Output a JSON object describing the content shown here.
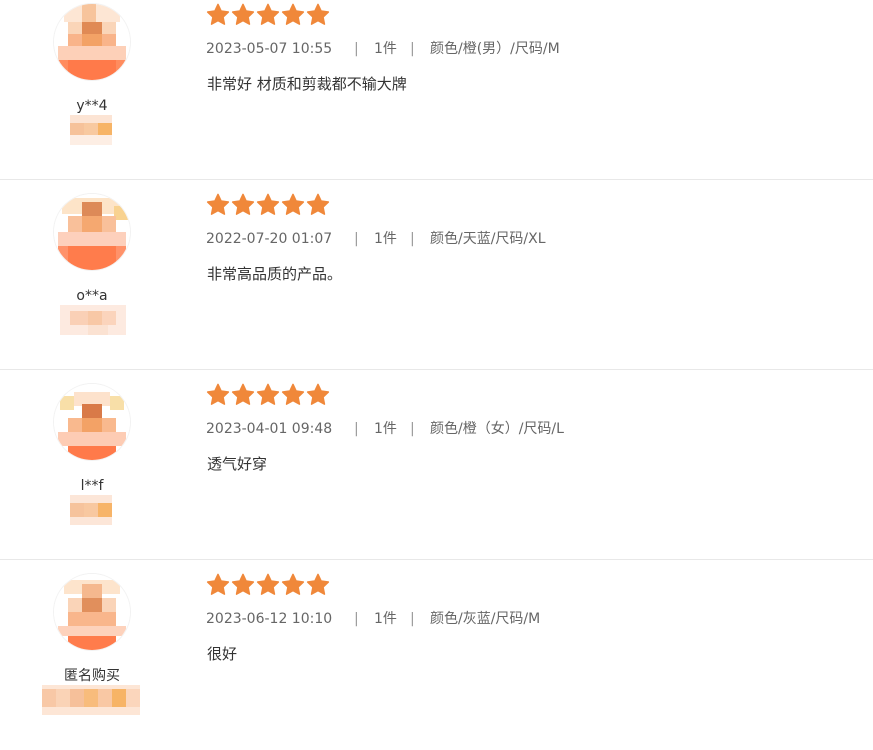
{
  "colors": {
    "star": "#f0883a",
    "divider": "#e8e8e8",
    "text": "#333333",
    "meta_text": "#666666"
  },
  "reviews": [
    {
      "username": "y**4",
      "rating": 5,
      "date": "2023-05-07 10:55",
      "quantity": "1件",
      "spec": "颜色/橙(男）/尺码/M",
      "comment": "非常好 材质和剪裁都不输大牌",
      "avatar_icon": "blurred-avatar-icon",
      "badge_icon": "blurred-level-badge-icon"
    },
    {
      "username": "o**a",
      "rating": 5,
      "date": "2022-07-20 01:07",
      "quantity": "1件",
      "spec": "颜色/天蓝/尺码/XL",
      "comment": "非常高品质的产品。",
      "avatar_icon": "blurred-avatar-icon",
      "badge_icon": "blurred-level-badge-icon"
    },
    {
      "username": "l**f",
      "rating": 5,
      "date": "2023-04-01 09:48",
      "quantity": "1件",
      "spec": "颜色/橙（女）/尺码/L",
      "comment": "透气好穿",
      "avatar_icon": "blurred-avatar-icon",
      "badge_icon": "blurred-level-badge-icon"
    },
    {
      "username": "匿名购买",
      "rating": 5,
      "date": "2023-06-12 10:10",
      "quantity": "1件",
      "spec": "颜色/灰蓝/尺码/M",
      "comment": "很好",
      "avatar_icon": "blurred-avatar-icon",
      "badge_icon": "blurred-level-badge-icon"
    }
  ],
  "separator": "|"
}
